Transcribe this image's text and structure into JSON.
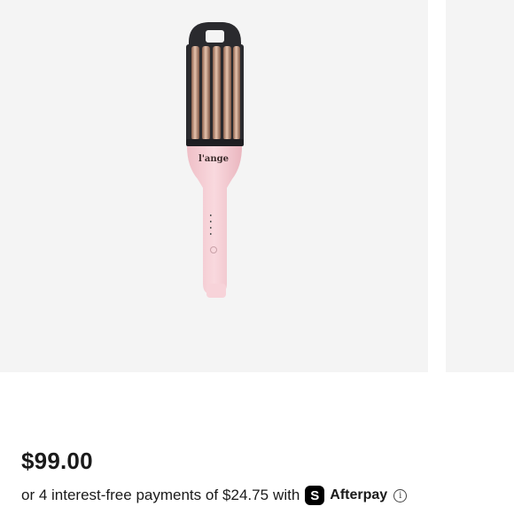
{
  "product": {
    "image_brand_text": "l'ange",
    "price": "$99.00",
    "installments": {
      "prefix": "or 4 interest-free payments of",
      "amount": "$24.75",
      "connector": "with",
      "badge_glyph": "S",
      "provider": "Afterpay",
      "info_icon": "info-icon"
    }
  },
  "colors": {
    "image_background": "#f4f4f4",
    "handle_pink": "#f6cdd4",
    "barrel_dark": "#2a2a2e",
    "rose_gold": "#c89d85"
  }
}
